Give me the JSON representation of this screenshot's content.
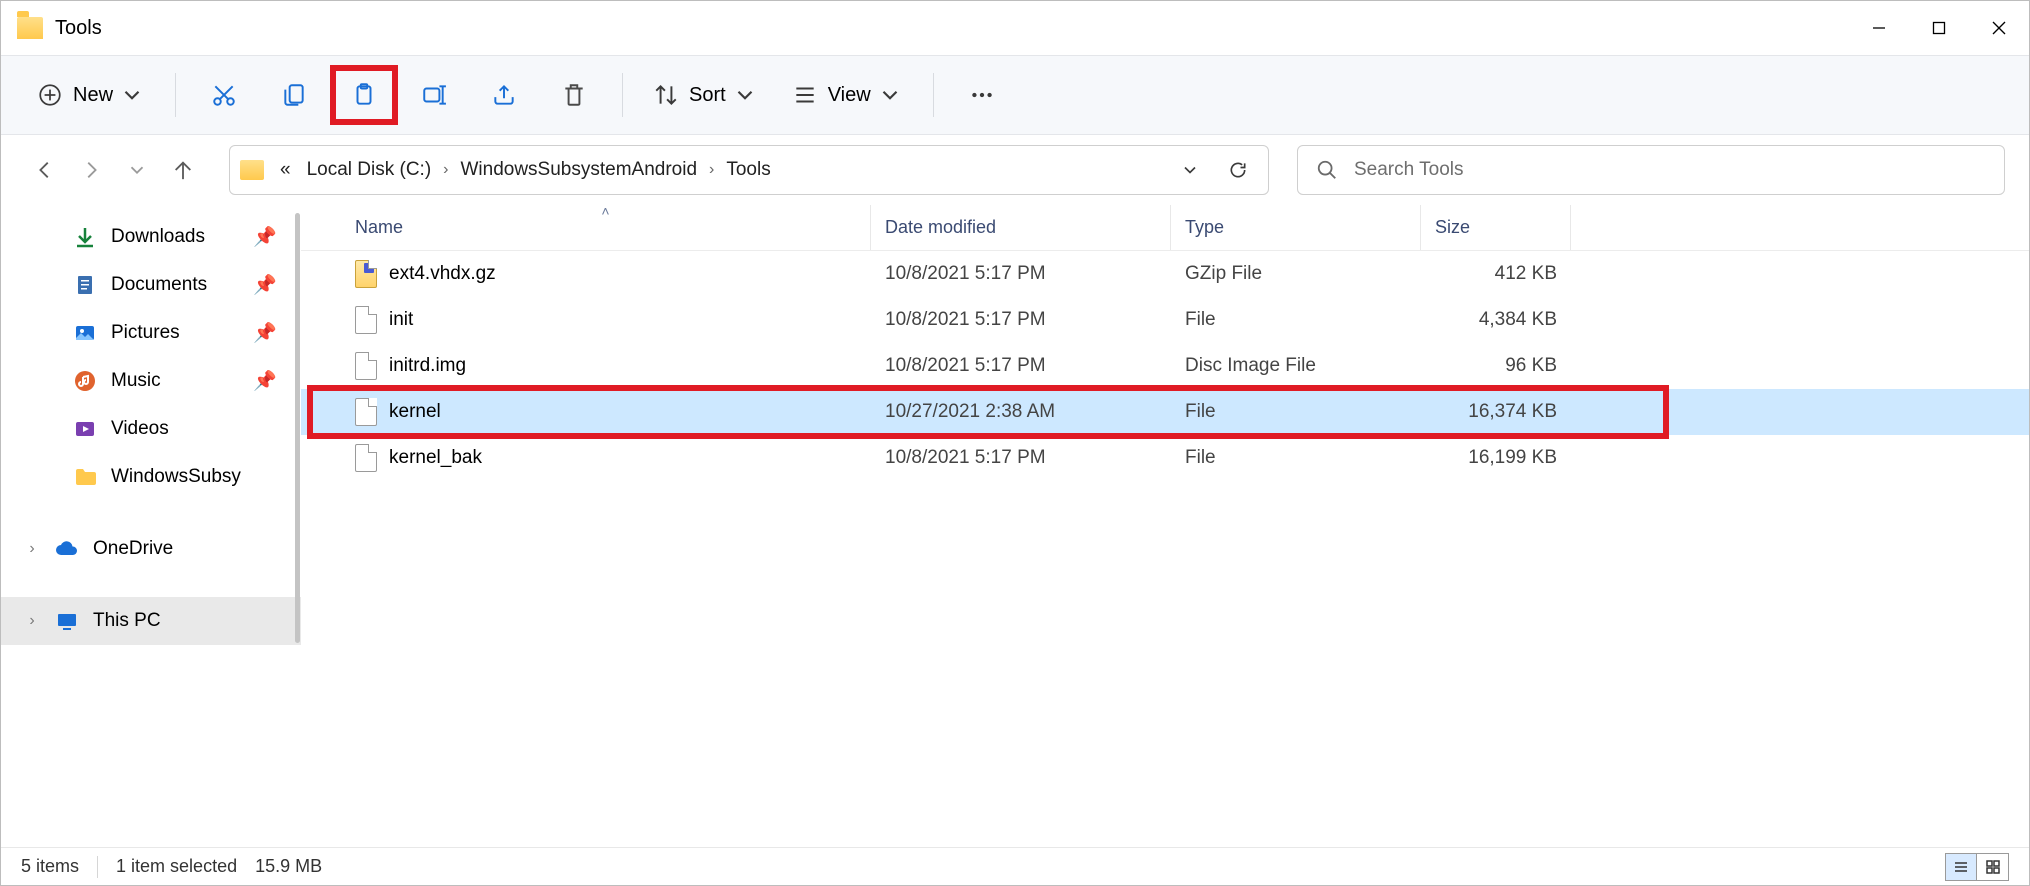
{
  "window": {
    "title": "Tools"
  },
  "toolbar": {
    "new_label": "New",
    "sort_label": "Sort",
    "view_label": "View"
  },
  "breadcrumb": {
    "prefix": "«",
    "items": [
      "Local Disk (C:)",
      "WindowsSubsystemAndroid",
      "Tools"
    ]
  },
  "search": {
    "placeholder": "Search Tools"
  },
  "sidebar": {
    "items": [
      {
        "label": "Downloads",
        "icon": "download",
        "pinned": true
      },
      {
        "label": "Documents",
        "icon": "document",
        "pinned": true
      },
      {
        "label": "Pictures",
        "icon": "pictures",
        "pinned": true
      },
      {
        "label": "Music",
        "icon": "music",
        "pinned": true
      },
      {
        "label": "Videos",
        "icon": "videos",
        "pinned": false
      },
      {
        "label": "WindowsSubsy",
        "icon": "folder",
        "pinned": false
      }
    ],
    "onedrive": "OneDrive",
    "thispc": "This PC"
  },
  "columns": {
    "name": "Name",
    "date": "Date modified",
    "type": "Type",
    "size": "Size"
  },
  "files": [
    {
      "name": "ext4.vhdx.gz",
      "date": "10/8/2021 5:17 PM",
      "type": "GZip File",
      "size": "412 KB",
      "icon": "archive"
    },
    {
      "name": "init",
      "date": "10/8/2021 5:17 PM",
      "type": "File",
      "size": "4,384 KB",
      "icon": "file"
    },
    {
      "name": "initrd.img",
      "date": "10/8/2021 5:17 PM",
      "type": "Disc Image File",
      "size": "96 KB",
      "icon": "file"
    },
    {
      "name": "kernel",
      "date": "10/27/2021 2:38 AM",
      "type": "File",
      "size": "16,374 KB",
      "icon": "file",
      "selected": true,
      "highlight": true
    },
    {
      "name": "kernel_bak",
      "date": "10/8/2021 5:17 PM",
      "type": "File",
      "size": "16,199 KB",
      "icon": "file"
    }
  ],
  "status": {
    "count": "5 items",
    "selection": "1 item selected",
    "size": "15.9 MB"
  }
}
